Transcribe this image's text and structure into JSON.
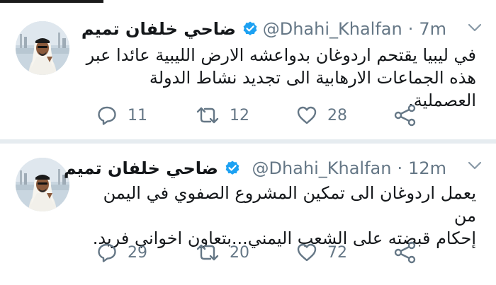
{
  "tweets": [
    {
      "display_name": "ضاحي خلفان تميم",
      "handle": "@Dhahi_Khalfan",
      "separator": "·",
      "time": "7m",
      "text_line1": "في ليبيا يقتحم اردوغان بدواعشه الارض الليبية عائدا عبر",
      "text_line2": "هذه الجماعات الارهابية الى تجديد نشاط الدولة العصملية.",
      "replies": "11",
      "retweets": "12",
      "likes": "28"
    },
    {
      "display_name": "ضاحي خلفان تميم",
      "handle": "@Dhahi_Khalfan",
      "separator": "·",
      "time": "12m",
      "text_line1": "يعمل اردوغان الى تمكين المشروع الصفوي في اليمن من",
      "text_line2": "إحكام قبضته على الشعب اليمني...بتعاون اخواني فريد.",
      "replies": "29",
      "retweets": "20",
      "likes": "72"
    }
  ],
  "colors": {
    "accent": "#1da1f2",
    "icon_gray": "#657786",
    "divider": "#e6ecf0"
  },
  "icons": [
    "chevron-down-icon",
    "verified-badge-icon",
    "reply-icon",
    "retweet-icon",
    "like-icon",
    "share-icon"
  ]
}
